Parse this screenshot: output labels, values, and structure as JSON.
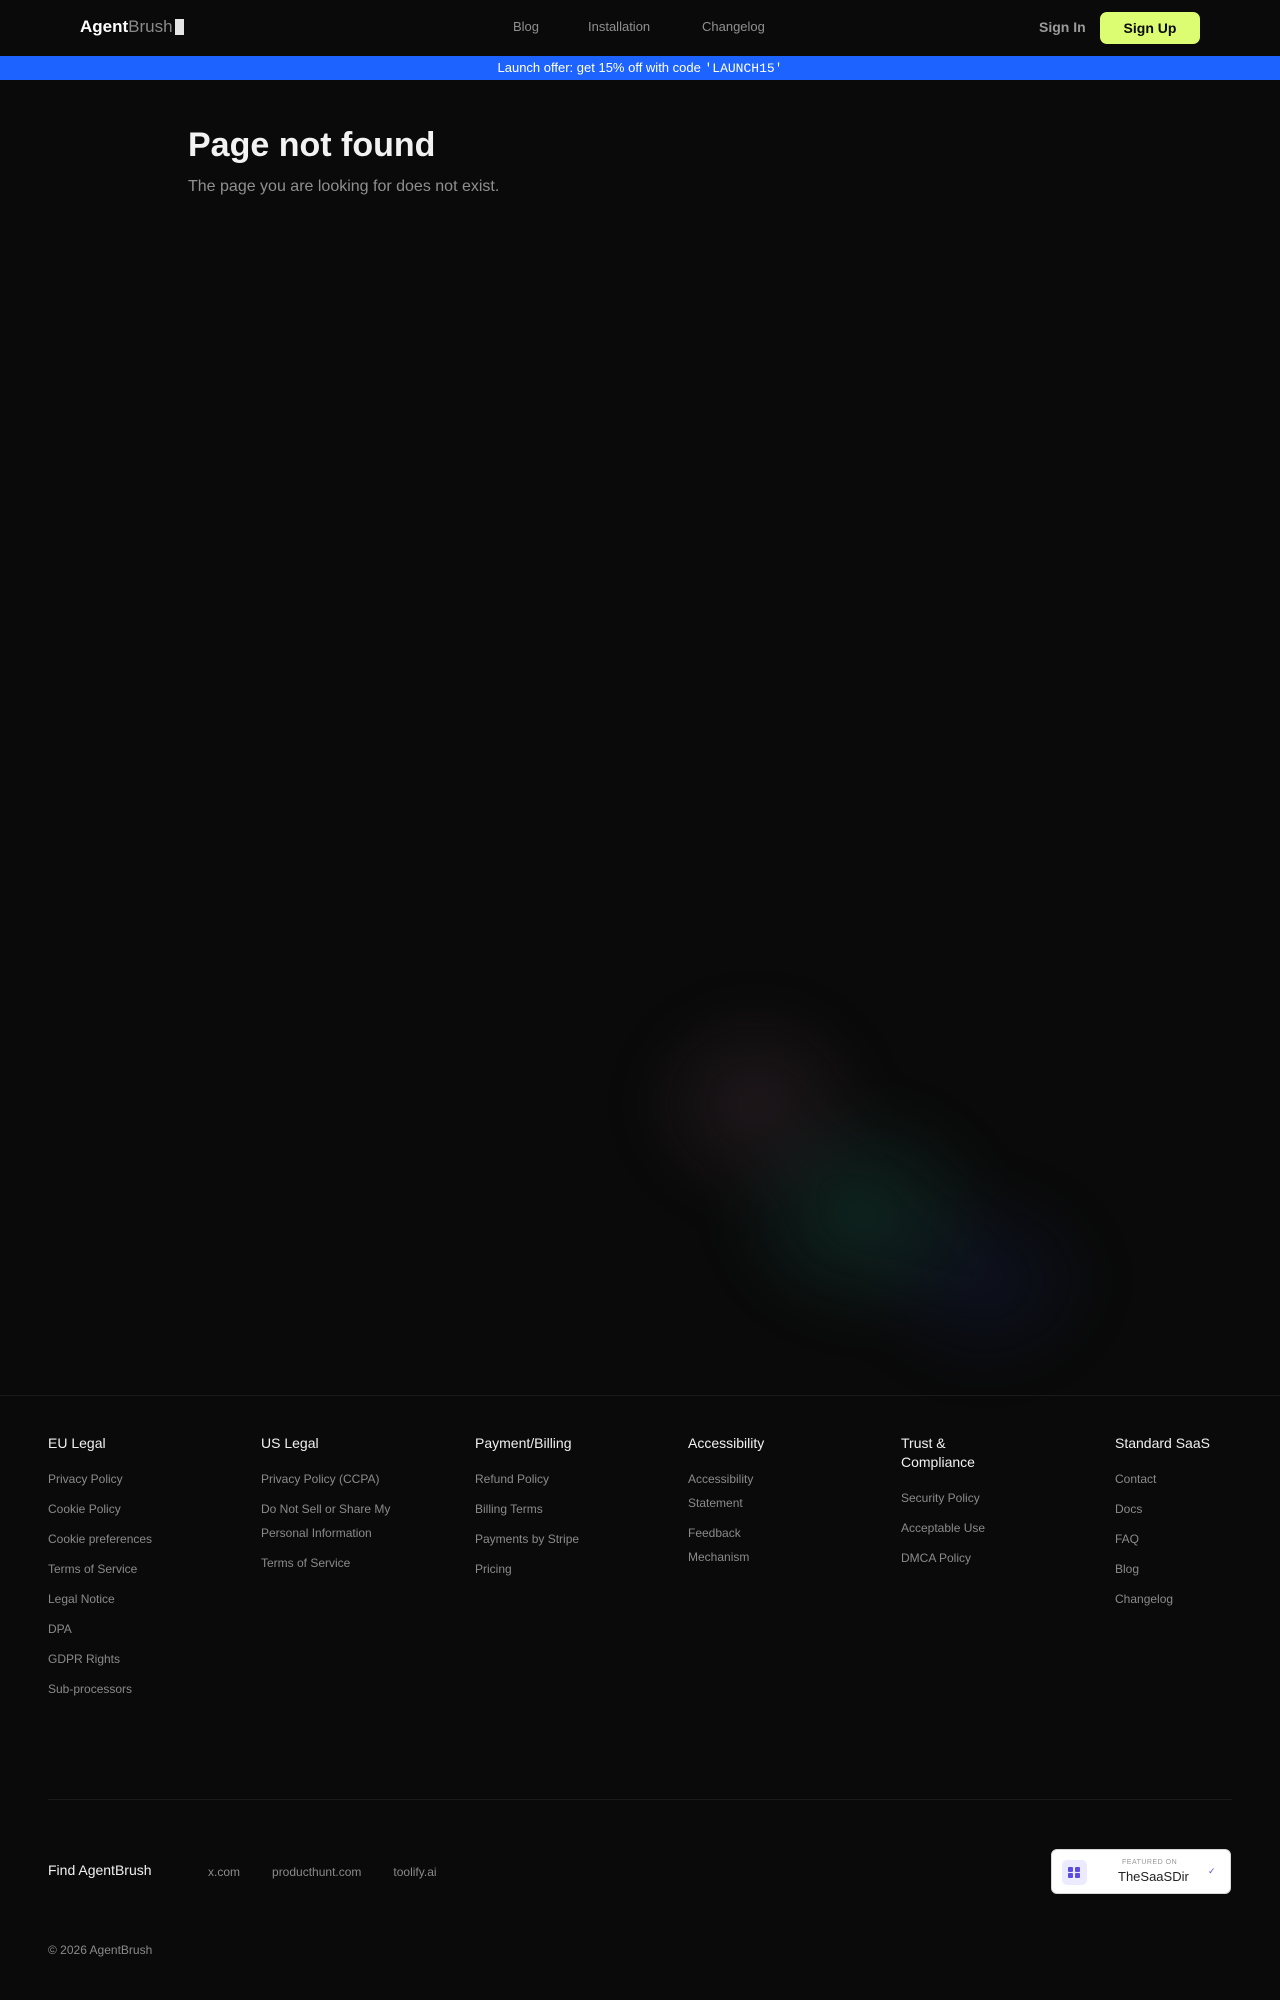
{
  "header": {
    "logo_strong": "Agent",
    "logo_light": "Brush",
    "nav": [
      "Blog",
      "Installation",
      "Changelog"
    ],
    "signin": "Sign In",
    "signup": "Sign Up"
  },
  "banner": {
    "text": "Launch offer: get 15% off with code ",
    "code": "'LAUNCH15'"
  },
  "main": {
    "title": "Page not found",
    "subtitle": "The page you are looking for does not exist."
  },
  "footer": {
    "columns": [
      {
        "title": "EU Legal",
        "items": [
          "Privacy Policy",
          "Cookie Policy",
          "Cookie preferences",
          "Terms of Service",
          "Legal Notice",
          "DPA",
          "GDPR Rights",
          "Sub-processors"
        ]
      },
      {
        "title": "US Legal",
        "items": [
          "Privacy Policy (CCPA)",
          "Do Not Sell or Share My Personal Information",
          "Terms of Service"
        ]
      },
      {
        "title": "Payment/Billing",
        "items": [
          "Refund Policy",
          "Billing Terms",
          "Payments by Stripe",
          "Pricing"
        ]
      },
      {
        "title": "Accessibility",
        "items": [
          "Accessibility Statement",
          "Feedback Mechanism"
        ]
      },
      {
        "title": "Trust & Compliance",
        "items": [
          "Security Policy",
          "Acceptable Use",
          "DMCA Policy"
        ]
      },
      {
        "title": "Standard SaaS",
        "items": [
          "Contact",
          "Docs",
          "FAQ",
          "Blog",
          "Changelog"
        ]
      }
    ],
    "find_title": "Find AgentBrush",
    "find_links": [
      "x.com",
      "producthunt.com",
      "toolify.ai"
    ],
    "badge": {
      "small": "FEATURED ON",
      "name": "TheSaaSDir"
    },
    "copyright": "© 2026 AgentBrush"
  },
  "colors": {
    "background": "#0a0a0a",
    "accent_button": "#dcfc72",
    "banner": "#1d63ff"
  },
  "icons": {
    "badge_icon": "grid-icon",
    "badge_check": "chevron-icon"
  }
}
